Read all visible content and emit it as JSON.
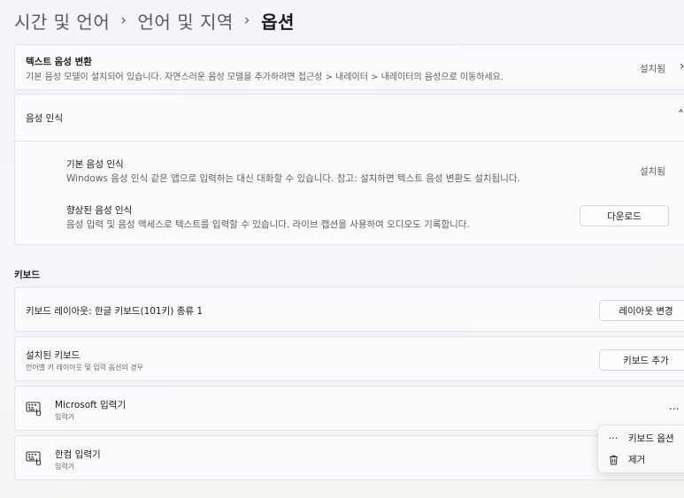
{
  "breadcrumb": {
    "items": [
      "시간 및 언어",
      "언어 및 지역"
    ],
    "separator": "›",
    "current": "옵션"
  },
  "tts": {
    "title": "텍스트 음성 변환",
    "description": "기본 음성 모델이 설치되어 있습니다. 자연스러운 음성 모델을 추가하려면 접근성 > 내레이터 > 내레이터의 음성으로 이동하세요.",
    "status": "설치됨",
    "chevron": "›"
  },
  "speech_recognition": {
    "header": "음성 인식",
    "chevron": "˄",
    "basic": {
      "title": "기본 음성 인식",
      "description": "Windows 음성 인식 같은 앱으로 입력하는 대신 대화할 수 있습니다. 참고: 설치하면 텍스트 음성 변환도 설치됩니다.",
      "status": "설치됨"
    },
    "enhanced": {
      "title": "향상된 음성 인식",
      "description": "음성 입력 및 음성 액세스로 텍스트를 입력할 수 있습니다. 라이브 캡션을 사용하여 오디오도 기록합니다.",
      "button": "다운로드"
    }
  },
  "keyboard": {
    "section_title": "키보드",
    "layout": {
      "title": "키보드 레이아웃: 한글 키보드(101키) 종류 1",
      "button": "레이아웃 변경"
    },
    "installed": {
      "title": "설치된 키보드",
      "subtitle": "언어별 키 레이아웃 및 입력 옵션의 경우",
      "button": "키보드 추가"
    },
    "ime_list": [
      {
        "name": "Microsoft 입력기",
        "type": "입력기",
        "more": "..."
      },
      {
        "name": "한컴 입력기",
        "type": "입력기"
      }
    ]
  },
  "context_menu": {
    "items": [
      {
        "label": "키보드 옵션",
        "icon": "ellipsis-icon",
        "glyph": "···"
      },
      {
        "label": "제거",
        "icon": "trash-icon"
      }
    ]
  }
}
